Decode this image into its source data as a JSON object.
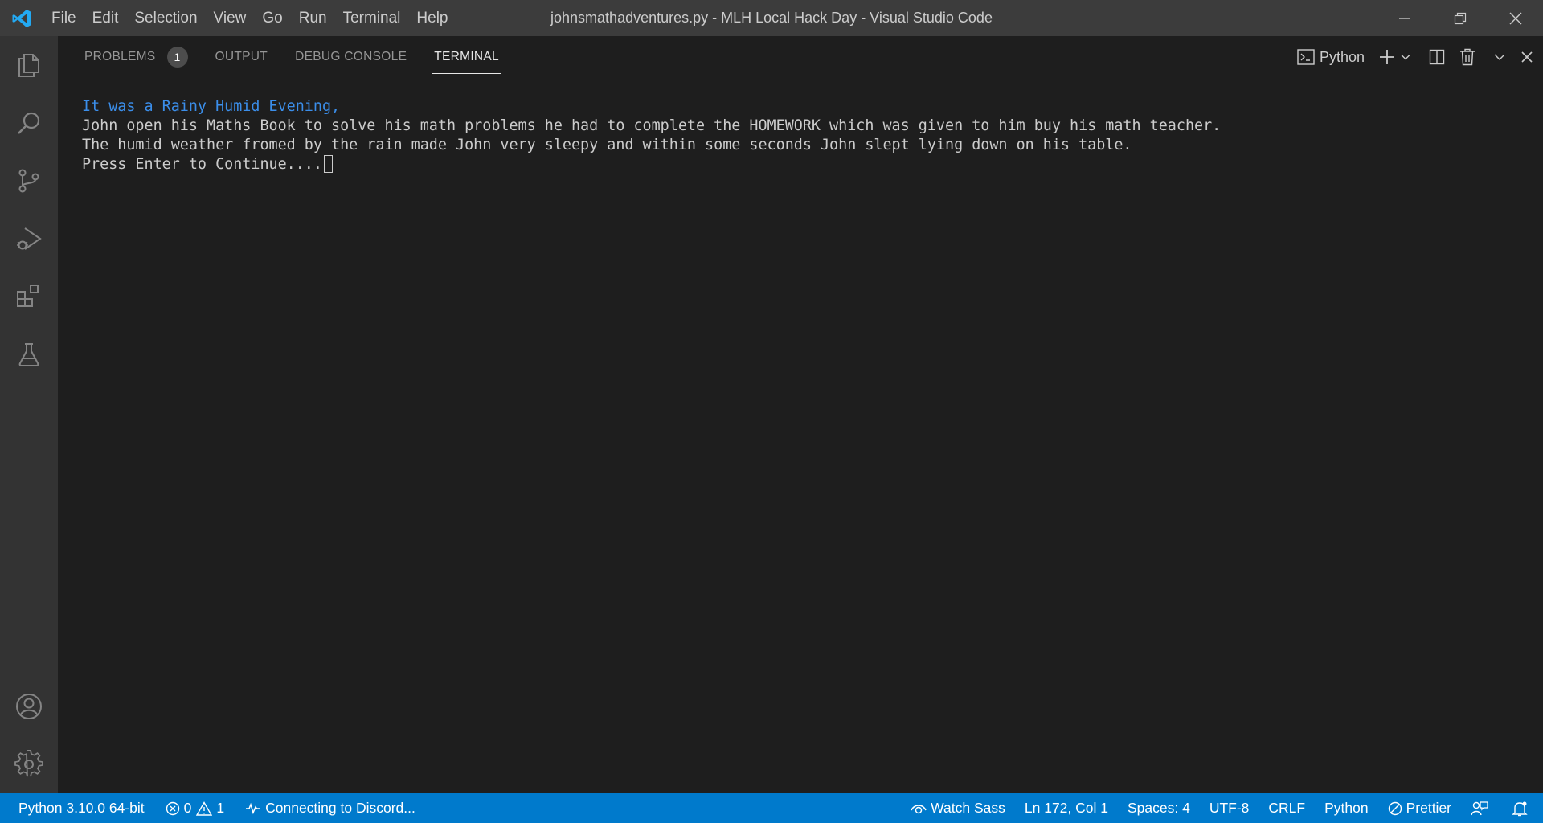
{
  "window": {
    "title": "johnsmathadventures.py - MLH Local Hack Day - Visual Studio Code"
  },
  "menu": [
    "File",
    "Edit",
    "Selection",
    "View",
    "Go",
    "Run",
    "Terminal",
    "Help"
  ],
  "activity_bar": {
    "items": [
      "files-icon",
      "search-icon",
      "source-control-icon",
      "run-debug-icon",
      "extensions-icon",
      "testing-icon"
    ],
    "bottom": [
      "account-icon",
      "gear-icon"
    ]
  },
  "panel": {
    "tabs": [
      {
        "label": "PROBLEMS",
        "badge": "1"
      },
      {
        "label": "OUTPUT"
      },
      {
        "label": "DEBUG CONSOLE"
      },
      {
        "label": "TERMINAL",
        "active": true
      }
    ],
    "terminal_profile": "Python"
  },
  "terminal": {
    "lines": [
      "It was a Rainy Humid Evening,",
      "John open his Maths Book to solve his math problems he had to complete the HOMEWORK which was given to him buy his math teacher.",
      "The humid weather fromed by the rain made John very sleepy and within some seconds John slept lying down on his table.",
      "Press Enter to Continue...."
    ],
    "first_line_color": "#3b8eea"
  },
  "status_bar": {
    "interpreter": "Python 3.10.0 64-bit",
    "errors": "0",
    "warnings": "1",
    "discord": "Connecting to Discord...",
    "watch_sass": "Watch Sass",
    "position": "Ln 172, Col 1",
    "spaces": "Spaces: 4",
    "encoding": "UTF-8",
    "eol": "CRLF",
    "language": "Python",
    "prettier": "Prettier",
    "color": "#007acc"
  }
}
